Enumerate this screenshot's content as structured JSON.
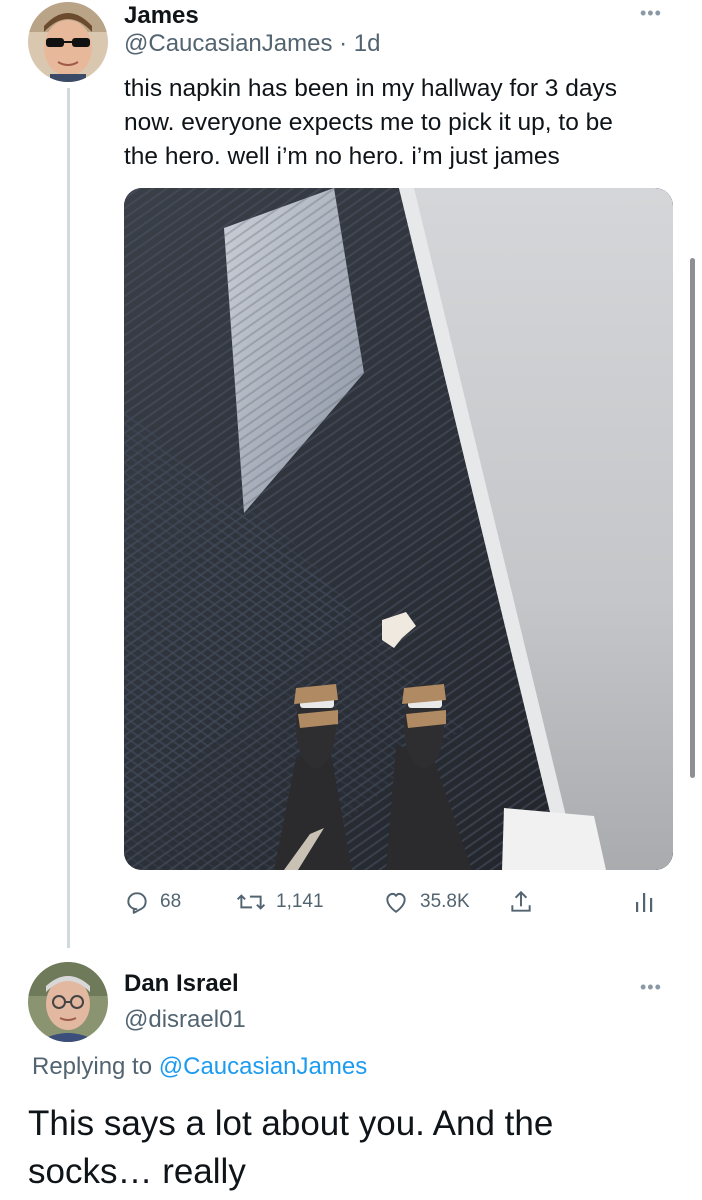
{
  "tweet": {
    "author_name": "James",
    "handle_time": "@CaucasianJames · 1d",
    "more": "•••",
    "text_lines": [
      "this napkin has been in my hallway for 3 days",
      "now. everyone expects me to pick it up, to be",
      "the hero. well i’m no hero. i’m just james"
    ],
    "media_icon": "photo",
    "actions": {
      "reply_icon": "reply-icon",
      "reply_count": "68",
      "retweet_icon": "retweet-icon",
      "retweet_count": "1,141",
      "like_icon": "heart-icon",
      "like_count": "35.8K",
      "share_icon": "share-icon",
      "analytics_icon": "analytics-icon"
    }
  },
  "reply": {
    "author_name": "Dan Israel",
    "handle": "@disrael01",
    "more": "•••",
    "replying_prefix": "Replying to ",
    "replying_handle": "@CaucasianJames",
    "text_lines": [
      "This says a lot about you. And the",
      "socks… really"
    ]
  },
  "colors": {
    "text": "#0f1419",
    "secondary": "#536471",
    "link": "#1d9bf0",
    "thread_line": "#cfd9de"
  }
}
